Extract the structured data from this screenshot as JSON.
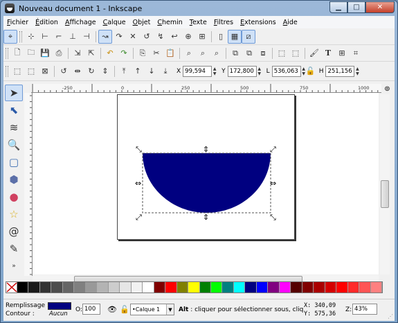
{
  "window": {
    "title": "Nouveau document 1 - Inkscape"
  },
  "menubar": [
    "Fichier",
    "Édition",
    "Affichage",
    "Calque",
    "Objet",
    "Chemin",
    "Texte",
    "Filtres",
    "Extensions",
    "Aide"
  ],
  "coords": {
    "x_label": "X",
    "x_value": "99,594",
    "y_label": "Y",
    "y_value": "172,800",
    "w_label": "L",
    "w_value": "536,063",
    "h_label": "H",
    "h_value": "251,156"
  },
  "ruler": {
    "h_ticks": [
      "-250",
      "0",
      "250",
      "500",
      "750",
      "1000"
    ]
  },
  "shape": {
    "fill_color": "#000080"
  },
  "palette": [
    "#000000",
    "#1a1a1a",
    "#333333",
    "#4d4d4d",
    "#666666",
    "#808080",
    "#999999",
    "#b3b3b3",
    "#cccccc",
    "#e6e6e6",
    "#f2f2f2",
    "#ffffff",
    "#800000",
    "#ff0000",
    "#808000",
    "#ffff00",
    "#008000",
    "#00ff00",
    "#008080",
    "#00ffff",
    "#000080",
    "#0000ff",
    "#800080",
    "#ff00ff",
    "#550000",
    "#800000",
    "#aa0000",
    "#d40000",
    "#ff0000",
    "#ff2a2a",
    "#ff5555",
    "#ff8080"
  ],
  "status": {
    "fill_label": "Remplissage :",
    "stroke_label": "Contour :",
    "fill_color": "#000080",
    "stroke_value": "Aucun",
    "opacity_label": "O:",
    "opacity_value": "100",
    "layer_value": "•Calque 1",
    "message_bold": "Alt",
    "message_rest": " : cliquer pour sélectionner sous, cliquer",
    "cursor_x": "X:  340,09",
    "cursor_y": "Y:  575,36",
    "zoom_label": "Z:",
    "zoom_value": "43%"
  }
}
